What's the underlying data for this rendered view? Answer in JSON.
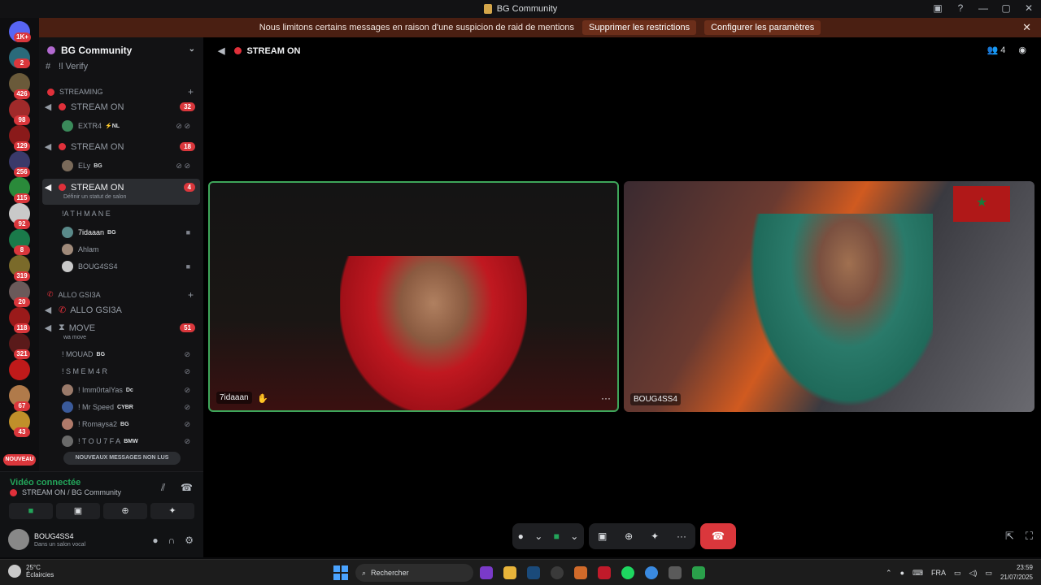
{
  "window": {
    "title": "BG Community",
    "controls": [
      "▣",
      "?",
      "—",
      "▢",
      "✕"
    ]
  },
  "banner": {
    "text": "Nous limitons certains messages en raison d'une suspicion de raid de mentions",
    "btn1": "Supprimer les restrictions",
    "btn2": "Configurer les paramètres",
    "close": "✕"
  },
  "guilds": {
    "badges": [
      "1K+",
      "2",
      "426",
      "98",
      "129",
      "256",
      "115",
      "92",
      "8",
      "319",
      "20",
      "118",
      "321",
      "67",
      "43"
    ],
    "nouveau": "NOUVEAU"
  },
  "server": {
    "name": "BG Community",
    "chevron": "⌄"
  },
  "channels": {
    "verify": "!l Verify",
    "cat_streaming": "STREAMING",
    "stream1": {
      "name": "STREAM ON",
      "count": "32"
    },
    "stream1_user": {
      "name": "EXTR4",
      "tag": "⚡NL"
    },
    "stream2": {
      "name": "STREAM ON",
      "count": "18"
    },
    "stream2_user": {
      "name": "ELy",
      "tag": "BG"
    },
    "stream3": {
      "name": "STREAM ON",
      "count": "4",
      "status": "Définir un statut de salon"
    },
    "stream3_users": [
      {
        "name": "!A T H M A N E",
        "tag": ""
      },
      {
        "name": "7idaaan",
        "tag": "BG"
      },
      {
        "name": "Ahlam",
        "tag": ""
      },
      {
        "name": "BOUG4SS4",
        "tag": ""
      }
    ],
    "cat_allo": "ALLO GSI3A",
    "allo": "ALLO GSI3A",
    "move": {
      "name": "MOVE",
      "count": "51",
      "status": "wa move"
    },
    "move_users": [
      {
        "name": "! MOUAD",
        "tag": "BG"
      },
      {
        "name": "! S M E M 4 R",
        "tag": ""
      },
      {
        "name": "! Imm0rtalYas",
        "tag": "Dc"
      },
      {
        "name": "! Mr Speed",
        "tag": "CYBR"
      },
      {
        "name": "! Romaysa2",
        "tag": "BG"
      },
      {
        "name": "! T O U 7 F A",
        "tag": "BMW"
      }
    ],
    "new_messages": "NOUVEAUX MESSAGES NON LUS"
  },
  "voice": {
    "title": "Vidéo connectée",
    "sub": "STREAM ON / BG Community"
  },
  "me": {
    "name": "BOUG4SS4",
    "status": "Dans un salon vocal"
  },
  "stage": {
    "channel": "STREAM ON",
    "member_count": "4",
    "tile1": "7idaaan",
    "tile2": "BOUG4SS4",
    "more": "···"
  },
  "taskbar": {
    "temp": "25°C",
    "weather": "Éclaircies",
    "search": "Rechercher",
    "lang": "FRA",
    "time": "23:59",
    "date": "21/07/2025"
  }
}
